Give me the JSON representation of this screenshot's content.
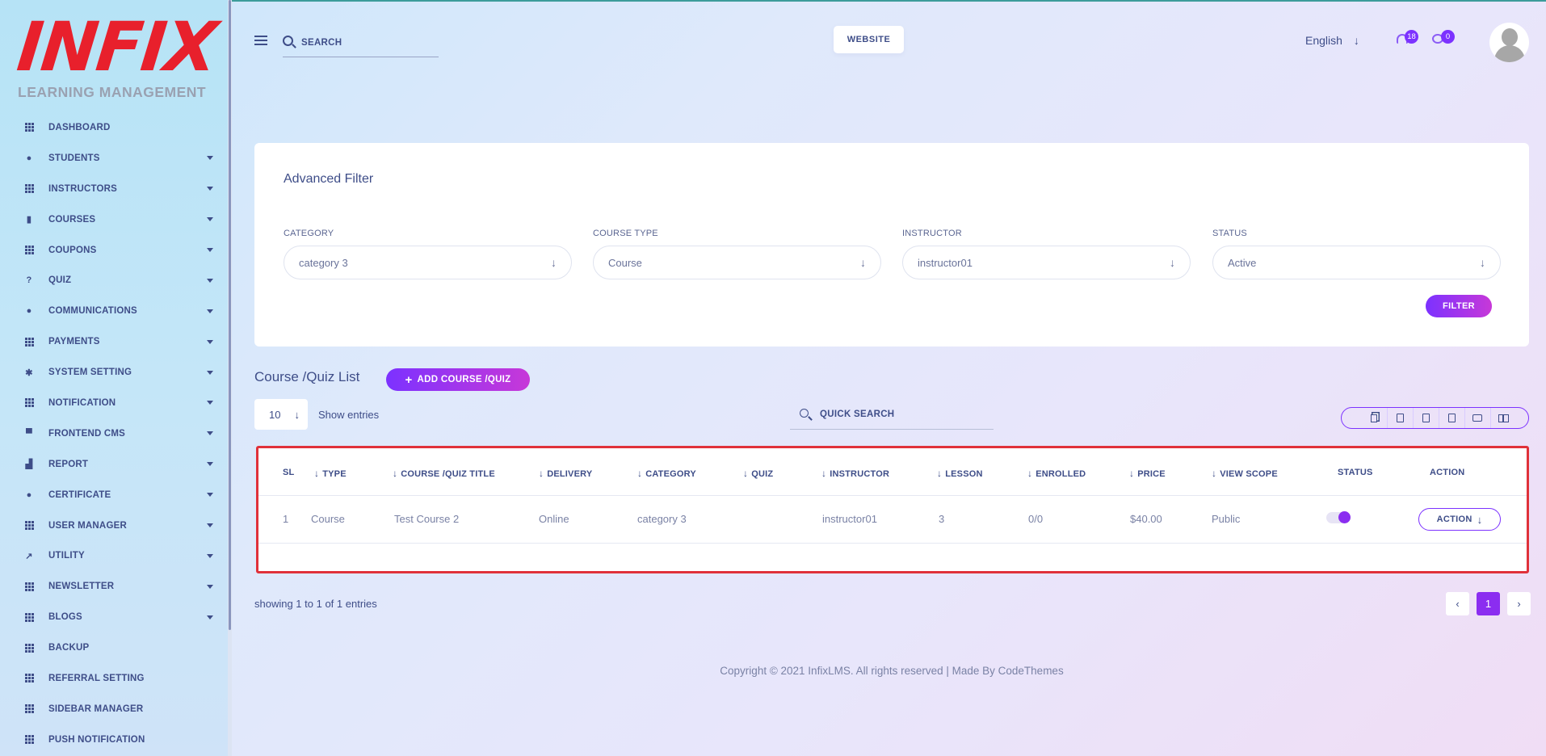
{
  "brand": {
    "logo_text": "INFIX",
    "logo_subtitle": "LEARNING MANAGEMENT"
  },
  "sidebar": {
    "items": [
      {
        "label": "DASHBOARD",
        "icon": "grid-icon",
        "has_submenu": false
      },
      {
        "label": "STUDENTS",
        "icon": "user-icon",
        "has_submenu": true
      },
      {
        "label": "INSTRUCTORS",
        "icon": "grid-icon",
        "has_submenu": true
      },
      {
        "label": "COURSES",
        "icon": "book-icon",
        "has_submenu": true
      },
      {
        "label": "COUPONS",
        "icon": "grid-icon",
        "has_submenu": true
      },
      {
        "label": "QUIZ",
        "icon": "question-icon",
        "has_submenu": true
      },
      {
        "label": "COMMUNICATIONS",
        "icon": "chat-icon",
        "has_submenu": true
      },
      {
        "label": "PAYMENTS",
        "icon": "grid-icon",
        "has_submenu": true
      },
      {
        "label": "SYSTEM SETTING",
        "icon": "cogs-icon",
        "has_submenu": true
      },
      {
        "label": "NOTIFICATION",
        "icon": "grid-icon",
        "has_submenu": true
      },
      {
        "label": "FRONTEND CMS",
        "icon": "paint-roller-icon",
        "has_submenu": true
      },
      {
        "label": "REPORT",
        "icon": "chart-icon",
        "has_submenu": true
      },
      {
        "label": "CERTIFICATE",
        "icon": "certificate-icon",
        "has_submenu": true
      },
      {
        "label": "USER MANAGER",
        "icon": "grid-icon",
        "has_submenu": true
      },
      {
        "label": "UTILITY",
        "icon": "hammer-icon",
        "has_submenu": true
      },
      {
        "label": "NEWSLETTER",
        "icon": "grid-icon",
        "has_submenu": true
      },
      {
        "label": "BLOGS",
        "icon": "grid-icon",
        "has_submenu": true
      },
      {
        "label": "BACKUP",
        "icon": "grid-icon",
        "has_submenu": false
      },
      {
        "label": "REFERRAL SETTING",
        "icon": "grid-icon",
        "has_submenu": false
      },
      {
        "label": "SIDEBAR MANAGER",
        "icon": "grid-icon",
        "has_submenu": false
      },
      {
        "label": "PUSH NOTIFICATION",
        "icon": "grid-icon",
        "has_submenu": false
      }
    ]
  },
  "header": {
    "search_placeholder": "SEARCH",
    "website_label": "WEBSITE",
    "language": "English",
    "notifications_count": "18",
    "messages_count": "0"
  },
  "filter": {
    "title": "Advanced Filter",
    "fields": [
      {
        "label": "CATEGORY",
        "value": "category 3"
      },
      {
        "label": "COURSE TYPE",
        "value": "Course"
      },
      {
        "label": "INSTRUCTOR",
        "value": "instructor01"
      },
      {
        "label": "STATUS",
        "value": "Active"
      }
    ],
    "button_label": "FILTER"
  },
  "list": {
    "title": "Course /Quiz List",
    "add_label": "ADD COURSE /QUIZ",
    "page_size": "10",
    "show_entries_label": "Show entries",
    "quick_search_placeholder": "QUICK SEARCH",
    "export_buttons": [
      "copy-icon",
      "excel-icon",
      "csv-icon",
      "pdf-icon",
      "print-icon",
      "columns-icon"
    ]
  },
  "table": {
    "columns": [
      "SL",
      "TYPE",
      "COURSE /QUIZ TITLE",
      "DELIVERY",
      "CATEGORY",
      "QUIZ",
      "INSTRUCTOR",
      "LESSON",
      "ENROLLED",
      "PRICE",
      "VIEW SCOPE",
      "STATUS",
      "ACTION"
    ],
    "rows": [
      {
        "sl": "1",
        "type": "Course",
        "title": "Test Course 2",
        "delivery": "Online",
        "category": "category 3",
        "quiz": "",
        "instructor": "instructor01",
        "lesson": "3",
        "enrolled": "0/0",
        "price": "$40.00",
        "view_scope": "Public",
        "status_on": true,
        "action_label": "ACTION"
      }
    ]
  },
  "footer": {
    "showing": "showing 1 to 1 of 1 entries",
    "current_page": "1",
    "copyright": "Copyright © 2021 InfixLMS. All rights reserved | Made By CodeThemes"
  },
  "colors": {
    "accent": "#7c32ff",
    "brand_red": "#e8202c",
    "text": "#3e4d88",
    "highlight_border": "#e0313a"
  }
}
